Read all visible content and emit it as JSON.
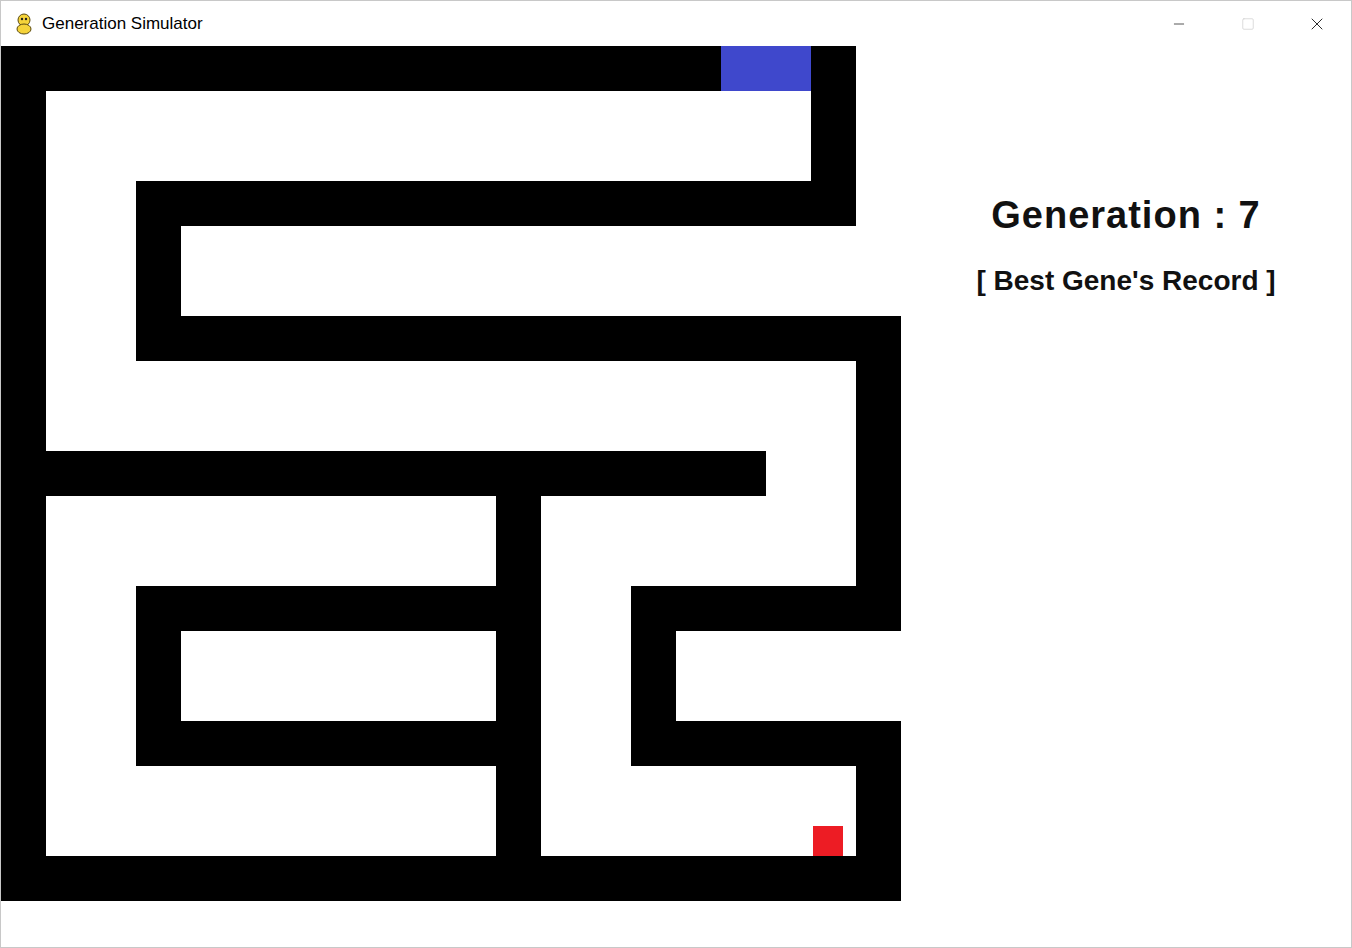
{
  "window": {
    "title": "Generation Simulator",
    "maximize_enabled": false
  },
  "hud": {
    "generation_label": "Generation : 7",
    "record_label": "[ Best Gene's Record ]"
  },
  "maze": {
    "rows": [
      "################GG#.",
      "#.................#.",
      "#.................#.",
      "#..################.",
      "#..#................",
      "#..#................",
      "#..#################",
      "#..................#",
      "#..................#",
      "#################..#",
      "#..........#.......#",
      "#..........#.......#",
      "#..#########..######",
      "#..#.......#..#.....",
      "#..#.......#..#.....",
      "#..#########..######",
      "#..........#.......#",
      "#..........#.......#",
      "####################"
    ],
    "agent": {
      "row": 17,
      "col": 18
    }
  }
}
